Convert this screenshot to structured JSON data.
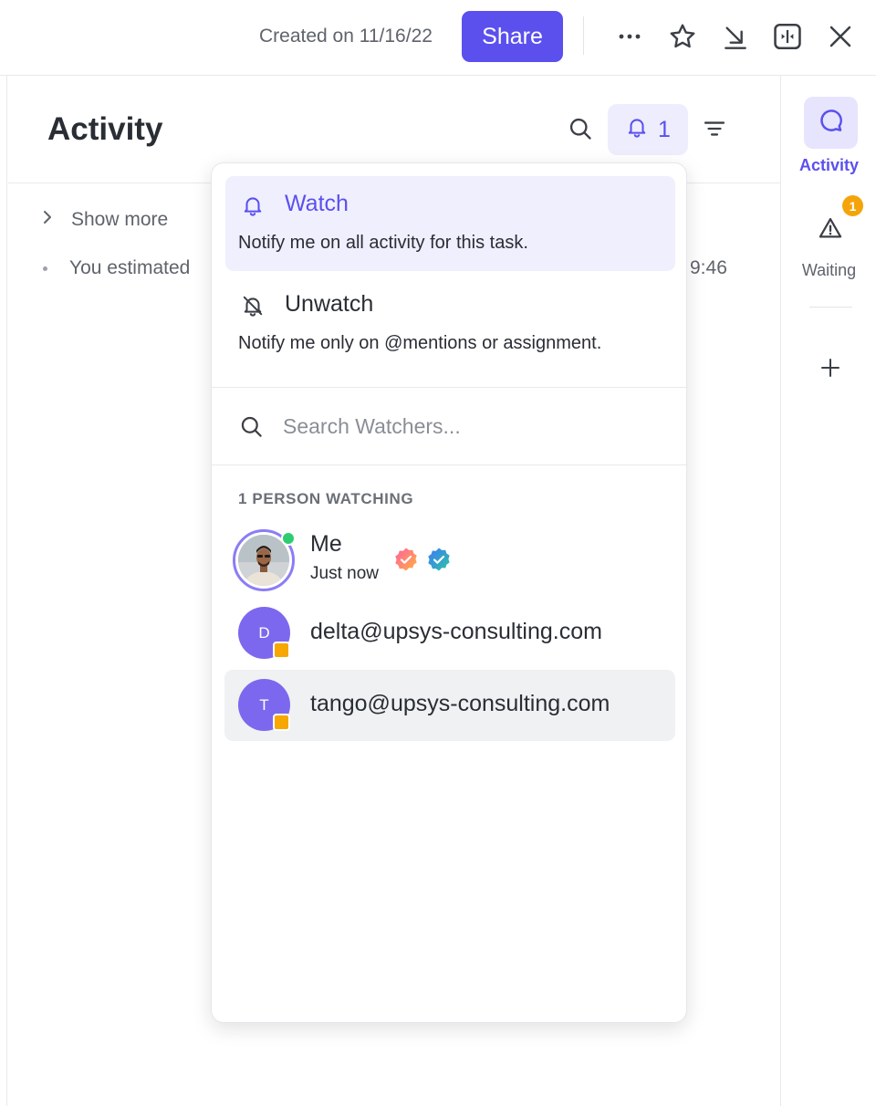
{
  "topbar": {
    "created_text": "Created on 11/16/22",
    "share_label": "Share",
    "icons": [
      "more-icon",
      "star-icon",
      "minimize-icon",
      "dock-icon",
      "close-icon"
    ]
  },
  "main": {
    "title": "Activity",
    "watch_count": "1",
    "show_more": "Show more",
    "estimated_text": "You estimated",
    "time_partial": "9:46"
  },
  "rail": {
    "activity_label": "Activity",
    "waiting_label": "Waiting",
    "waiting_badge": "1"
  },
  "dropdown": {
    "watch": {
      "title": "Watch",
      "description": "Notify me on all activity for this task."
    },
    "unwatch": {
      "title": "Unwatch",
      "description": "Notify me only on @mentions or assignment."
    },
    "search_placeholder": "Search Watchers...",
    "watching_header": "1 PERSON WATCHING",
    "people": [
      {
        "name": "Me",
        "subtitle": "Just now"
      },
      {
        "initial": "D",
        "email": "delta@upsys-consulting.com"
      },
      {
        "initial": "T",
        "email": "tango@upsys-consulting.com"
      }
    ]
  },
  "colors": {
    "accent": "#5b50ee",
    "accent_light": "#f0effd",
    "avatar": "#7c68ee",
    "warning_badge": "#f4a40a",
    "guest_mark": "#f6a700",
    "online": "#2ecc71"
  }
}
